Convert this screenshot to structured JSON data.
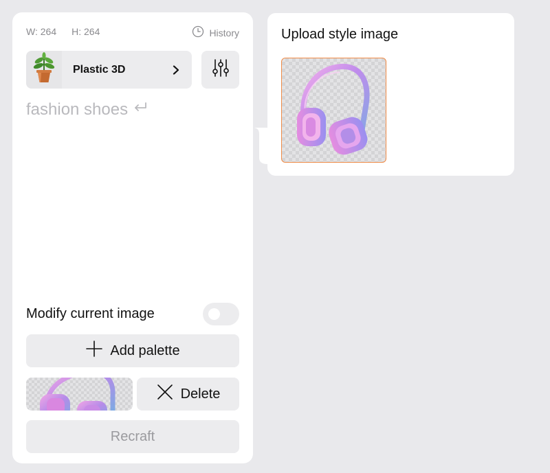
{
  "dimensions": {
    "width_label": "W: 264",
    "height_label": "H: 264"
  },
  "history": {
    "label": "History",
    "icon": "clock-icon"
  },
  "style": {
    "name": "Plastic 3D",
    "thumbnail_icon": "potted-plant-icon"
  },
  "prompt": {
    "text": "fashion shoes",
    "icon": "return-arrow-icon"
  },
  "modify": {
    "label": "Modify current image",
    "enabled": false
  },
  "palette": {
    "add_label": "Add palette",
    "delete_label": "Delete"
  },
  "actions": {
    "recraft_label": "Recraft"
  },
  "upload": {
    "title": "Upload style image",
    "image_icon": "headphones-image"
  },
  "colors": {
    "accent_border": "#f08a45",
    "panel_bg": "#ffffff",
    "page_bg": "#e9e9ec",
    "button_bg": "#ececee"
  }
}
